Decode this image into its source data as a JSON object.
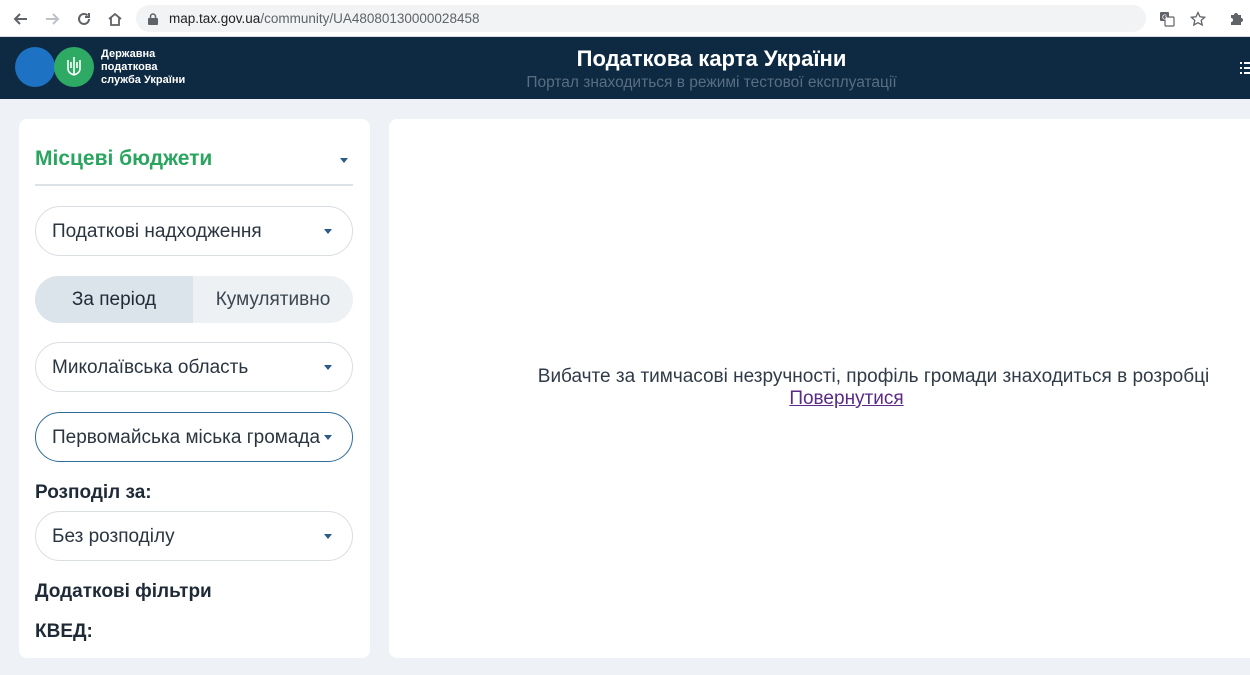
{
  "browser": {
    "url_host": "map.tax.gov.ua",
    "url_path": "/community/UA48080130000028458"
  },
  "header": {
    "logo_lines": [
      "Державна",
      "податкова",
      "служба України"
    ],
    "title": "Податкова карта України",
    "subtitle": "Портал знаходиться в режимі тестової експлуатації"
  },
  "sidebar": {
    "budget_select": "Місцеві бюджети",
    "revenue_select": "Податкові надходження",
    "period_toggle": {
      "selected": "За період",
      "other": "Кумулятивно"
    },
    "region_select": "Миколаївська область",
    "community_select": "Первомайська міська громада",
    "distribution_label": "Розподіл за:",
    "distribution_select": "Без розподілу",
    "additional_filters_label": "Додаткові фільтри",
    "kved_label": "КВЕД:"
  },
  "main": {
    "message": "Вибачте за тимчасові незручності, профіль громади знаходиться в розробці",
    "back_link": "Повернутися"
  },
  "colors": {
    "header_bg": "#0d2a42",
    "brand_green": "#2aa560",
    "brand_blue": "#1d72c4",
    "link_purple": "#5a2a86"
  }
}
